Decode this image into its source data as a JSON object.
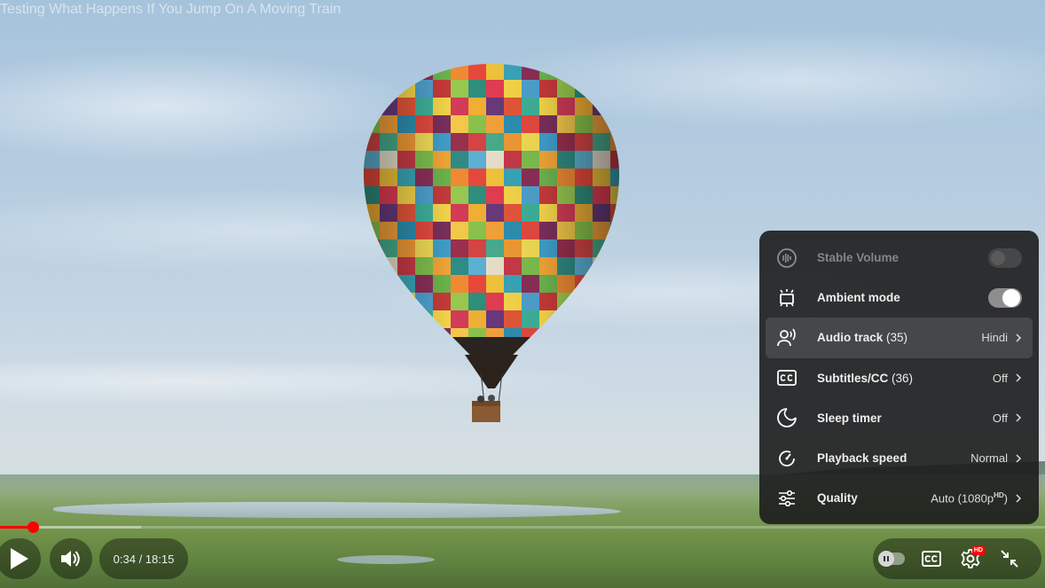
{
  "video": {
    "title": "Testing What Happens If You Jump On A Moving Train"
  },
  "settings_menu": {
    "items": [
      {
        "label": "Stable Volume",
        "icon": "stable-volume-icon",
        "control": "toggle",
        "state": "off",
        "disabled": true
      },
      {
        "label": "Ambient mode",
        "icon": "ambient-mode-icon",
        "control": "toggle",
        "state": "on"
      },
      {
        "label": "Audio track",
        "count": "(35)",
        "icon": "audio-track-icon",
        "value": "Hindi",
        "highlighted": true
      },
      {
        "label": "Subtitles/CC",
        "count": "(36)",
        "icon": "subtitles-icon",
        "value": "Off"
      },
      {
        "label": "Sleep timer",
        "icon": "sleep-timer-icon",
        "value": "Off"
      },
      {
        "label": "Playback speed",
        "icon": "playback-speed-icon",
        "value": "Normal"
      },
      {
        "label": "Quality",
        "icon": "quality-icon",
        "value": "Auto (1080p",
        "value_sup": "HD",
        "value_suffix": ")"
      }
    ]
  },
  "player": {
    "time_display": "0:34 / 18:15",
    "played_fraction": 0.031,
    "loaded_fraction": 0.135,
    "hd_badge": "HD",
    "colors": {
      "progress": "#ff0000",
      "badge": "#ff0000"
    }
  }
}
